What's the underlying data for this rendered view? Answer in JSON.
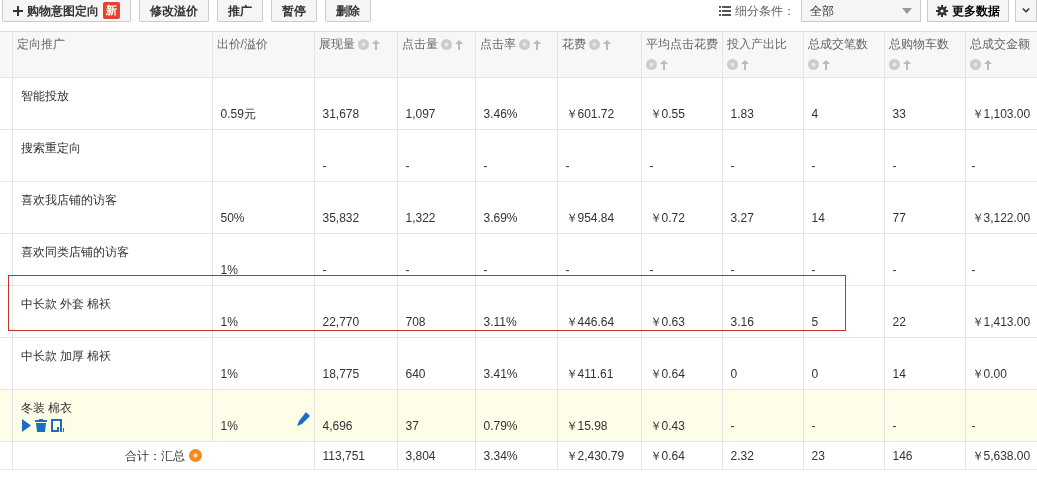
{
  "toolbar": {
    "buttons": [
      {
        "label": "购物意图定向",
        "kind": "add",
        "badge": "新"
      },
      {
        "label": "修改溢价",
        "kind": "plain"
      },
      {
        "label": "推广",
        "kind": "plain"
      },
      {
        "label": "暂停",
        "kind": "plain"
      },
      {
        "label": "删除",
        "kind": "plain"
      }
    ],
    "filter": {
      "label": "细分条件：",
      "value": "全部"
    },
    "more_data": {
      "label": "更多数据"
    }
  },
  "table": {
    "columns": [
      {
        "label": "定向推广",
        "help": false,
        "sortable": false
      },
      {
        "label": "出价/溢价",
        "help": false,
        "sortable": false
      },
      {
        "label": "展现量",
        "help": true,
        "sortable": true
      },
      {
        "label": "点击量",
        "help": true,
        "sortable": true
      },
      {
        "label": "点击率",
        "help": true,
        "sortable": true
      },
      {
        "label": "花费",
        "help": true,
        "sortable": true
      },
      {
        "label": "平均点击花费",
        "help": true,
        "sortable": true
      },
      {
        "label": "投入产出比",
        "help": true,
        "sortable": true
      },
      {
        "label": "总成交笔数",
        "help": true,
        "sortable": true
      },
      {
        "label": "总购物车数",
        "help": true,
        "sortable": true
      },
      {
        "label": "总成交金额",
        "help": true,
        "sortable": true
      }
    ],
    "rows": [
      {
        "cells": [
          "智能投放",
          "0.59元",
          "31,678",
          "1,097",
          "3.46%",
          "￥601.72",
          "￥0.55",
          "1.83",
          "4",
          "33",
          "￥1,103.00"
        ],
        "highlighted": false,
        "outlined": false
      },
      {
        "cells": [
          "搜索重定向",
          "",
          "-",
          "-",
          "-",
          "-",
          "-",
          "-",
          "-",
          "-",
          "-"
        ],
        "highlighted": false,
        "outlined": false
      },
      {
        "cells": [
          "喜欢我店铺的访客",
          "50%",
          "35,832",
          "1,322",
          "3.69%",
          "￥954.84",
          "￥0.72",
          "3.27",
          "14",
          "77",
          "￥3,122.00"
        ],
        "highlighted": false,
        "outlined": false
      },
      {
        "cells": [
          "喜欢同类店铺的访客",
          "1%",
          "-",
          "-",
          "-",
          "-",
          "-",
          "-",
          "-",
          "-",
          "-"
        ],
        "highlighted": false,
        "outlined": false
      },
      {
        "cells": [
          "中长款 外套 棉袄",
          "1%",
          "22,770",
          "708",
          "3.11%",
          "￥446.64",
          "￥0.63",
          "3.16",
          "5",
          "22",
          "￥1,413.00"
        ],
        "highlighted": false,
        "outlined": true
      },
      {
        "cells": [
          "中长款 加厚 棉袄",
          "1%",
          "18,775",
          "640",
          "3.41%",
          "￥411.61",
          "￥0.64",
          "0",
          "0",
          "14",
          "￥0.00"
        ],
        "highlighted": false,
        "outlined": false
      },
      {
        "cells": [
          "冬装 棉衣",
          "1%",
          "4,696",
          "37",
          "0.79%",
          "￥15.98",
          "￥0.43",
          "-",
          "-",
          "-",
          "-"
        ],
        "highlighted": true,
        "outlined": false
      }
    ],
    "total": {
      "label": "合计：汇总",
      "cells": [
        "113,751",
        "3,804",
        "3.34%",
        "￥2,430.79",
        "￥0.64",
        "2.32",
        "23",
        "146",
        "￥5,638.00"
      ]
    }
  }
}
